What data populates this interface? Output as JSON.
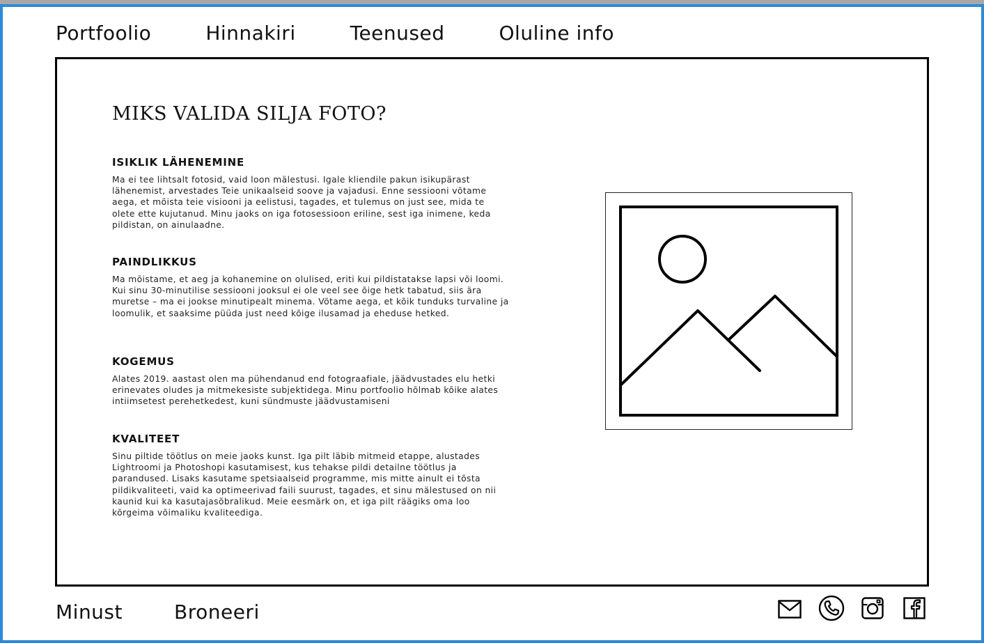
{
  "top_nav": {
    "items": [
      {
        "label": "Portfoolio"
      },
      {
        "label": "Hinnakiri"
      },
      {
        "label": "Teenused"
      },
      {
        "label": "Oluline info"
      }
    ]
  },
  "main": {
    "title": "MIKS VALIDA SILJA FOTO?",
    "sections": [
      {
        "heading": "ISIKLIK LÄHENEMINE",
        "text": "Ma ei tee lihtsalt fotosid, vaid loon mälestusi. Igale kliendile pakun isikupärast lähenemist, arvestades Teie unikaalseid soove ja vajadusi. Enne sessiooni võtame aega, et mõista teie visiooni ja eelistusi, tagades, et tulemus on just see, mida te olete ette kujutanud. Minu jaoks on iga fotosessioon eriline, sest iga inimene, keda pildistan, on ainulaadne."
      },
      {
        "heading": "PAINDLIKKUS",
        "text": "Ma mõistame, et aeg ja kohanemine on olulised, eriti kui pildistatakse lapsi või loomi. Kui sinu 30-minutilise sessiooni jooksul ei ole veel see õige hetk tabatud, siis ära muretse – ma ei jookse minutipealt minema. Võtame aega, et kõik tunduks turvaline ja loomulik, et saaksime püüda just need kõige ilusamad ja eheduse hetked."
      },
      {
        "heading": "KOGEMUS",
        "text": "Alates 2019. aastast olen ma pühendanud end fotograafiale, jäädvustades elu hetki erinevates oludes ja mitmekesiste subjektidega. Minu portfoolio hõlmab kõike alates intiimsetest perehetkedest, kuni  sündmuste jäädvustamiseni"
      },
      {
        "heading": "KVALITEET",
        "text": "Sinu piltide töötlus on meie jaoks kunst. Iga pilt läbib mitmeid etappe, alustades Lightroomi ja Photoshopi kasutamisest, kus tehakse pildi detailne töötlus ja parandused. Lisaks kasutame spetsiaalseid programme, mis mitte ainult ei tõsta pildikvaliteeti, vaid ka optimeerivad faili suurust, tagades, et sinu mälestused on nii kaunid kui ka kasutajasõbralikud. Meie eesmärk on, et iga pilt räägiks oma loo kõrgeima võimaliku kvaliteediga."
      }
    ],
    "image_icon": "image-placeholder-icon"
  },
  "bottom_nav": {
    "items": [
      {
        "label": "Minust"
      },
      {
        "label": "Broneeri"
      }
    ]
  },
  "social_icons": [
    "mail-icon",
    "phone-icon",
    "instagram-icon",
    "facebook-icon"
  ],
  "colors": {
    "frame_border": "#2a8ad9",
    "outer_background": "#a7a7a7",
    "page_background": "#ffffff",
    "ink": "#000000"
  }
}
